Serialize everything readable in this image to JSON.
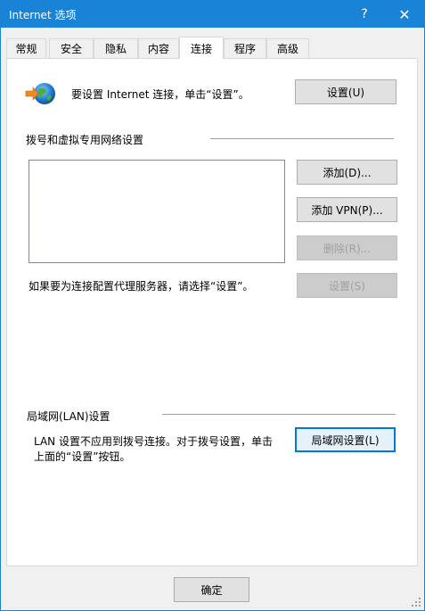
{
  "window": {
    "title": "Internet 选项",
    "help": "?",
    "close": "✕"
  },
  "tabs": [
    {
      "label": "常规"
    },
    {
      "label": "安全"
    },
    {
      "label": "隐私"
    },
    {
      "label": "内容"
    },
    {
      "label": "连接",
      "active": true
    },
    {
      "label": "程序"
    },
    {
      "label": "高级"
    }
  ],
  "setup": {
    "text": "要设置 Internet 连接，单击“设置”。",
    "button": "设置(U)"
  },
  "dialup": {
    "heading": "拨号和虚拟专用网络设置",
    "add_button": "添加(D)...",
    "add_vpn_button": "添加 VPN(P)...",
    "remove_button": "删除(R)...",
    "proxy_text": "如果要为连接配置代理服务器，请选择“设置”。",
    "settings_button": "设置(S)"
  },
  "lan": {
    "heading": "局域网(LAN)设置",
    "text_line1": "LAN 设置不应用到拨号连接。对于拨号设置，单击",
    "text_line2": "上面的“设置”按钮。",
    "button": "局域网设置(L)"
  },
  "footer": {
    "ok_button": "确定"
  },
  "colors": {
    "titlebar": "#1883d7",
    "panel": "#ffffff",
    "window_bg": "#f0f0f0",
    "focus": "#0078d7"
  }
}
